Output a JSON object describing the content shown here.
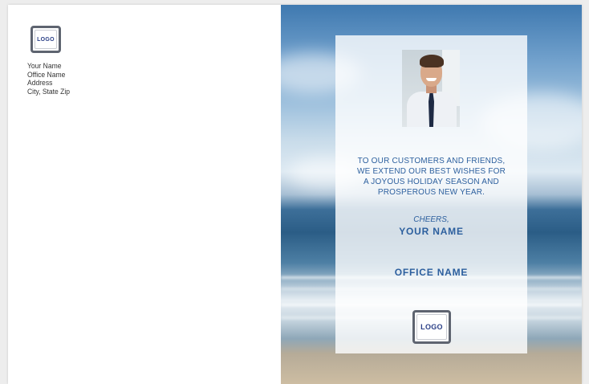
{
  "card": {
    "back": {
      "logo_text": "LOGO",
      "address_lines": [
        "Your Name",
        "Office Name",
        "Address",
        "City, State Zip"
      ]
    },
    "front": {
      "photo_icon": "agent-portrait",
      "message_lines": [
        "TO OUR CUSTOMERS AND FRIENDS,",
        "WE EXTEND OUR BEST WISHES FOR",
        "A JOYOUS HOLIDAY SEASON AND",
        "PROSPEROUS NEW YEAR."
      ],
      "signoff": "CHEERS,",
      "signature_name": "YOUR NAME",
      "office_name": "OFFICE NAME",
      "logo_text": "LOGO"
    }
  },
  "colors": {
    "text_blue": "#2c5f9e",
    "logo_blue": "#2a3f86",
    "logo_border": "#5e6470"
  }
}
